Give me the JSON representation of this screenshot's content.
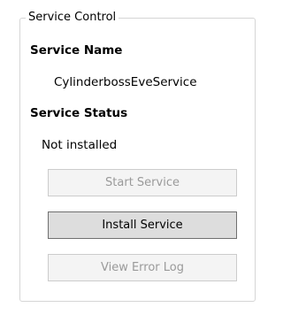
{
  "group": {
    "title": "Service Control"
  },
  "service_name": {
    "heading": "Service Name",
    "value": "CylinderbossEveService"
  },
  "service_status": {
    "heading": "Service Status",
    "value": "Not installed"
  },
  "buttons": {
    "start": {
      "label": "Start Service",
      "enabled": false
    },
    "install": {
      "label": "Install Service",
      "enabled": true
    },
    "error_log": {
      "label": "View Error Log",
      "enabled": false
    }
  },
  "colors": {
    "group_border": "#d5d5d5",
    "button_enabled_bg": "#dddddd",
    "button_enabled_border": "#707070",
    "button_disabled_bg": "#f4f4f4",
    "button_disabled_border": "#cccccc",
    "button_disabled_text": "#9a9a9a"
  }
}
